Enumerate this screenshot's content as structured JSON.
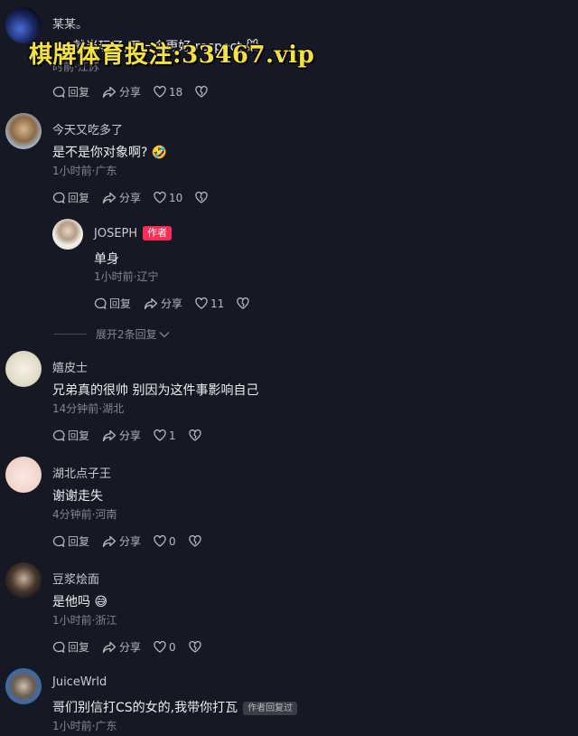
{
  "watermark": "棋牌体育投注:33467.vip",
  "comments": [
    {
      "name": "某某。",
      "text": "…                    ,就当玩了,下一个更好,respect 🐭",
      "meta": "时前·江苏",
      "reply": "回复",
      "share": "分享",
      "likes": "18"
    },
    {
      "name": "今天又吃多了",
      "text": "是不是你对象啊? 🤣",
      "meta": "1小时前·广东",
      "reply": "回复",
      "share": "分享",
      "likes": "10"
    },
    {
      "name": "JOSEPH",
      "author_badge": "作者",
      "text": "单身",
      "meta": "1小时前·辽宁",
      "reply": "回复",
      "share": "分享",
      "likes": "11"
    },
    {
      "name": "嬉皮士",
      "text": "兄弟真的很帅 别因为这件事影响自己",
      "meta": "14分钟前·湖北",
      "reply": "回复",
      "share": "分享",
      "likes": "1"
    },
    {
      "name": "湖北点子王",
      "text": "谢谢走失",
      "meta": "4分钟前·河南",
      "reply": "回复",
      "share": "分享",
      "likes": "0"
    },
    {
      "name": "豆浆烩面",
      "text": "是他吗 😅",
      "meta": "1小时前·浙江",
      "reply": "回复",
      "share": "分享",
      "likes": "0"
    },
    {
      "name": "JuiceWrld",
      "text": "哥们别信打CS的女的,我带你打瓦",
      "reply_badge": "作者回复过",
      "meta": "1小时前·广东"
    }
  ],
  "expand_replies": "展开2条回复",
  "colors": {
    "background": "#161823",
    "author_badge": "#fe2c55",
    "watermark": "#f5e23a"
  }
}
